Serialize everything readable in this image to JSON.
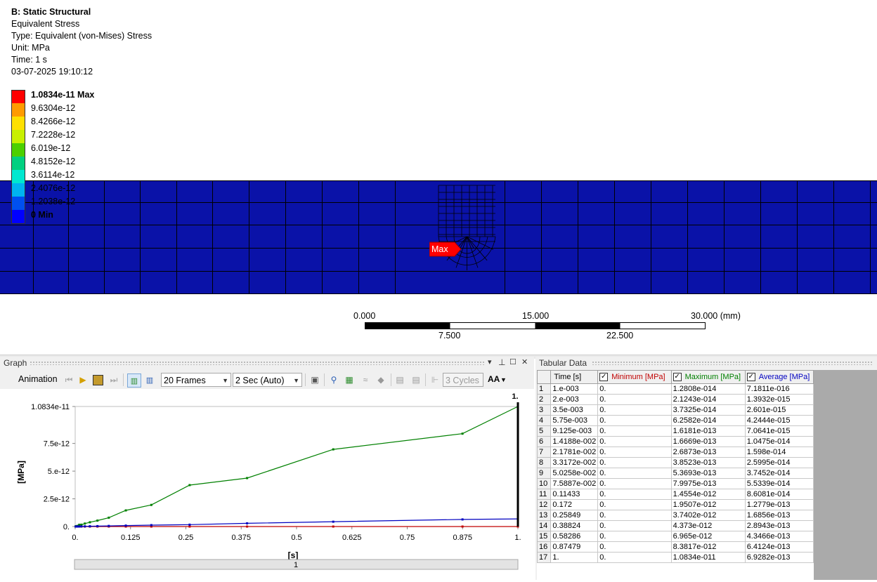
{
  "info": {
    "title": "B: Static Structural",
    "result": "Equivalent Stress",
    "type": "Type: Equivalent (von-Mises) Stress",
    "unit": "Unit: MPa",
    "time": "Time: 1 s",
    "timestamp": "03-07-2025 19:10:12"
  },
  "legend": {
    "labels": [
      "1.0834e-11 Max",
      "9.6304e-12",
      "8.4266e-12",
      "7.2228e-12",
      "6.019e-12",
      "4.8152e-12",
      "3.6114e-12",
      "2.4076e-12",
      "1.2038e-12",
      "0 Min"
    ],
    "colors": [
      "#ff0000",
      "#ff9b00",
      "#ffe000",
      "#c8f000",
      "#4cd000",
      "#00d080",
      "#00e8d0",
      "#00b4f0",
      "#0050f0",
      "#0000ff"
    ]
  },
  "viewport": {
    "body_color": "#0a12a8",
    "max_tag": "Max"
  },
  "scalebar": {
    "top_labels": [
      "0.000",
      "15.000",
      "30.000 (mm)"
    ],
    "bottom_labels": [
      "7.500",
      "22.500"
    ]
  },
  "graph": {
    "title": "Graph",
    "pin_icon": "pin-icon",
    "animation_label": "Animation",
    "frames": "20 Frames",
    "duration": "2 Sec (Auto)",
    "cycles": "3 Cycles",
    "aa": "AA",
    "slider_label": "1"
  },
  "chart_data": {
    "type": "line",
    "xlabel": "[s]",
    "ylabel": "[MPa]",
    "xlim": [
      0,
      1
    ],
    "ylim": [
      0,
      1.0834e-11
    ],
    "x_ticks": [
      "0.",
      "0.125",
      "0.25",
      "0.375",
      "0.5",
      "0.625",
      "0.75",
      "0.875",
      "1."
    ],
    "y_ticks": [
      "0.",
      "2.5e-12",
      "5.e-12",
      "7.5e-12",
      "1.0834e-11"
    ],
    "y_tick_values": [
      0,
      2.5e-12,
      5e-12,
      7.5e-12,
      1.0834e-11
    ],
    "cursor_label": "1.",
    "x": [
      0.001,
      0.002,
      0.0035,
      0.00575,
      0.009125,
      0.014188,
      0.021781,
      0.033172,
      0.050258,
      0.075887,
      0.11433,
      0.172,
      0.25849,
      0.38824,
      0.58286,
      0.87479,
      1.0
    ],
    "series": [
      {
        "name": "Minimum [MPa]",
        "color": "#c00000",
        "values": [
          0,
          0,
          0,
          0,
          0,
          0,
          0,
          0,
          0,
          0,
          0,
          0,
          0,
          0,
          0,
          0,
          0
        ]
      },
      {
        "name": "Maximum [MPa]",
        "color": "#008000",
        "values": [
          1.2808e-14,
          2.1243e-14,
          3.7325e-14,
          6.2582e-14,
          1.6181e-13,
          1.6669e-13,
          2.6873e-13,
          3.8523e-13,
          5.3693e-13,
          7.9975e-13,
          1.4554e-12,
          1.9507e-12,
          3.7402e-12,
          4.373e-12,
          6.965e-12,
          8.3817e-12,
          1.0834e-11
        ]
      },
      {
        "name": "Average [MPa]",
        "color": "#0000c0",
        "values": [
          7.1811e-16,
          1.3932e-15,
          2.601e-15,
          4.2444e-15,
          7.0641e-15,
          1.0475e-14,
          1.598e-14,
          2.5995e-14,
          3.7452e-14,
          5.5339e-14,
          8.6081e-14,
          1.2779e-13,
          1.6856e-13,
          2.8943e-13,
          4.3466e-13,
          6.4124e-13,
          6.9282e-13
        ]
      }
    ]
  },
  "table": {
    "title": "Tabular Data",
    "headers": [
      "",
      "Time [s]",
      "Minimum [MPa]",
      "Maximum [MPa]",
      "Average [MPa]"
    ],
    "header_colors": [
      "#000000",
      "#000000",
      "#c00000",
      "#008000",
      "#0000c0"
    ],
    "rows": [
      [
        "1",
        "1.e-003",
        "0.",
        "1.2808e-014",
        "7.1811e-016"
      ],
      [
        "2",
        "2.e-003",
        "0.",
        "2.1243e-014",
        "1.3932e-015"
      ],
      [
        "3",
        "3.5e-003",
        "0.",
        "3.7325e-014",
        "2.601e-015"
      ],
      [
        "4",
        "5.75e-003",
        "0.",
        "6.2582e-014",
        "4.2444e-015"
      ],
      [
        "5",
        "9.125e-003",
        "0.",
        "1.6181e-013",
        "7.0641e-015"
      ],
      [
        "6",
        "1.4188e-002",
        "0.",
        "1.6669e-013",
        "1.0475e-014"
      ],
      [
        "7",
        "2.1781e-002",
        "0.",
        "2.6873e-013",
        "1.598e-014"
      ],
      [
        "8",
        "3.3172e-002",
        "0.",
        "3.8523e-013",
        "2.5995e-014"
      ],
      [
        "9",
        "5.0258e-002",
        "0.",
        "5.3693e-013",
        "3.7452e-014"
      ],
      [
        "10",
        "7.5887e-002",
        "0.",
        "7.9975e-013",
        "5.5339e-014"
      ],
      [
        "11",
        "0.11433",
        "0.",
        "1.4554e-012",
        "8.6081e-014"
      ],
      [
        "12",
        "0.172",
        "0.",
        "1.9507e-012",
        "1.2779e-013"
      ],
      [
        "13",
        "0.25849",
        "0.",
        "3.7402e-012",
        "1.6856e-013"
      ],
      [
        "14",
        "0.38824",
        "0.",
        "4.373e-012",
        "2.8943e-013"
      ],
      [
        "15",
        "0.58286",
        "0.",
        "6.965e-012",
        "4.3466e-013"
      ],
      [
        "16",
        "0.87479",
        "0.",
        "8.3817e-012",
        "6.4124e-013"
      ],
      [
        "17",
        "1.",
        "0.",
        "1.0834e-011",
        "6.9282e-013"
      ]
    ]
  }
}
